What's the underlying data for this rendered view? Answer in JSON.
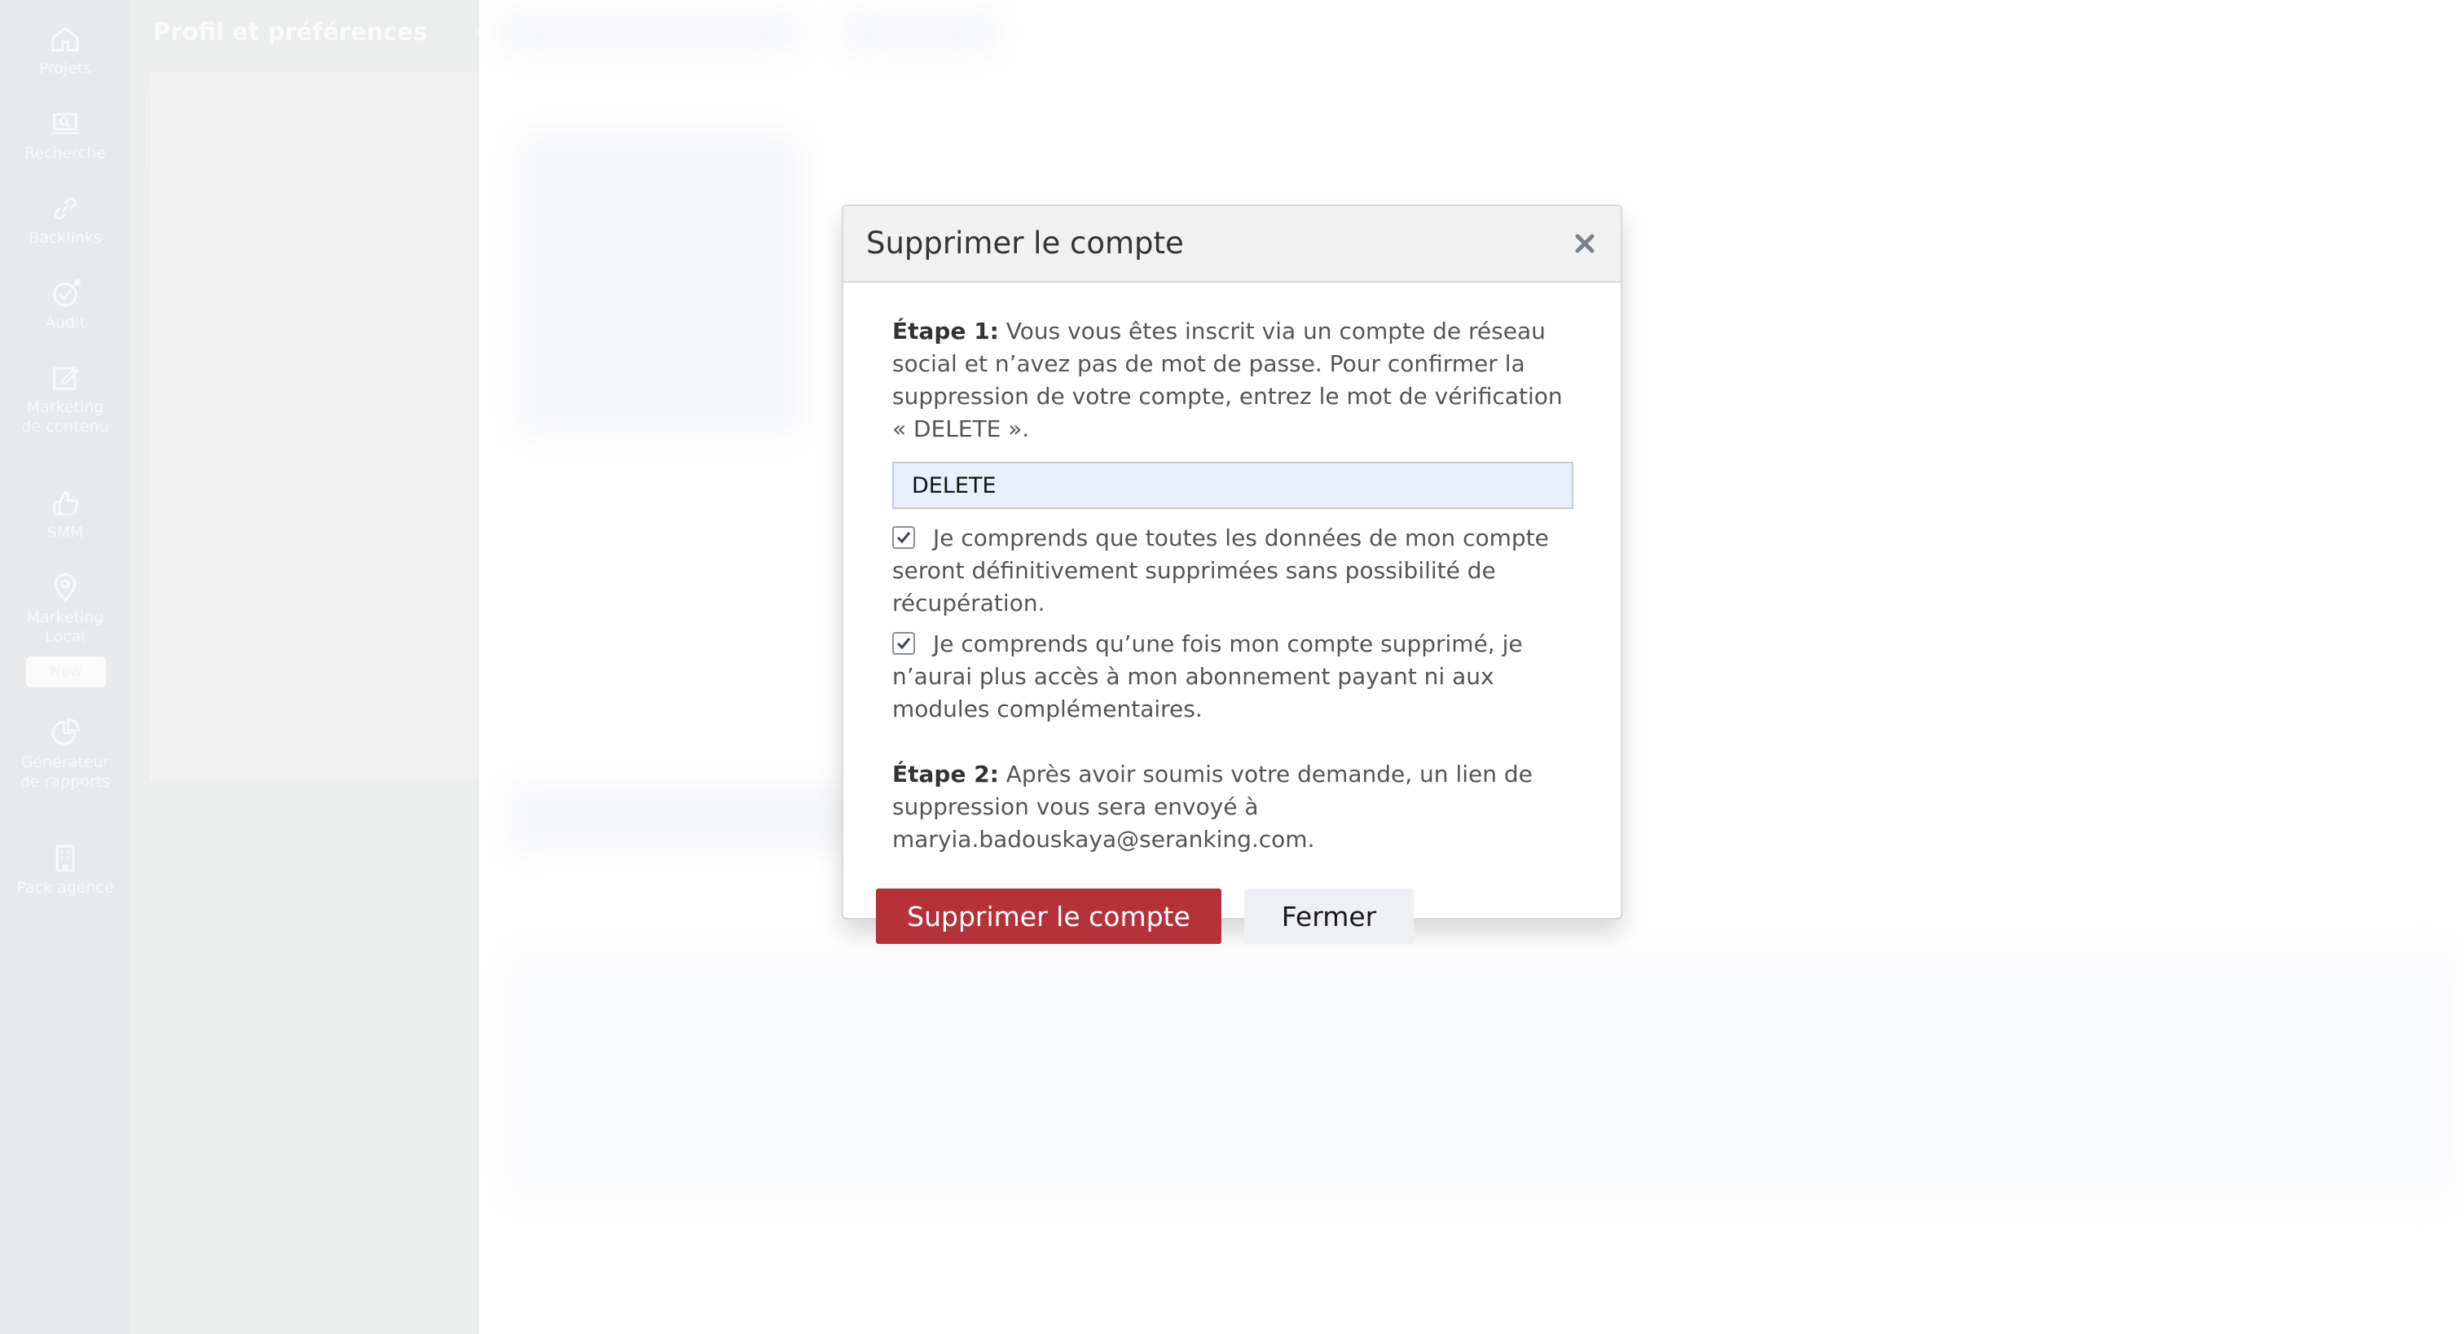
{
  "rail": {
    "items": [
      {
        "icon": "home-icon",
        "label": "Projets"
      },
      {
        "icon": "search-laptop-icon",
        "label": "Recherche"
      },
      {
        "icon": "link-icon",
        "label": "Backlinks"
      },
      {
        "icon": "check-circle-icon",
        "label": "Audit"
      },
      {
        "icon": "edit-icon",
        "label": "Marketing de contenu"
      },
      {
        "icon": "thumbs-up-icon",
        "label": "SMM"
      },
      {
        "icon": "map-pin-icon",
        "label": "Marketing Local"
      },
      {
        "icon": "pie-chart-icon",
        "label": "Générateur de rapports"
      },
      {
        "icon": "building-icon",
        "label": "Pack agence"
      }
    ],
    "new_badge": "New"
  },
  "subpanel": {
    "title": "Profil et préférences",
    "collapse_icon": "chevron-left-icon"
  },
  "modal": {
    "title": "Supprimer le compte",
    "close_icon": "close-icon",
    "step1_label": "Étape 1:",
    "step1_text": " Vous vous êtes inscrit via un compte de réseau social et n’avez pas de mot de passe. Pour confirmer la suppression de votre compte, entrez le mot de vérification « DELETE ».",
    "delete_input_value": "DELETE",
    "checkbox1_text": "Je comprends que toutes les données de mon compte seront définitivement supprimées sans possibilité de récupération.",
    "checkbox1_checked": true,
    "checkbox2_text": "Je comprends qu’une fois mon compte supprimé, je n’aurai plus accès à mon abonnement payant ni aux modules complémentaires.",
    "checkbox2_checked": true,
    "step2_label": "Étape 2:",
    "step2_text": " Après avoir soumis votre demande, un lien de suppression vous sera envoyé à maryia.badouskaya@seranking.com.",
    "delete_button": "Supprimer le compte",
    "close_button": "Fermer"
  },
  "colors": {
    "danger": "#b5323a",
    "rail_bg": "#e8e9eb",
    "modal_header_bg": "#f1f1f1",
    "input_bg": "#e8effd"
  }
}
